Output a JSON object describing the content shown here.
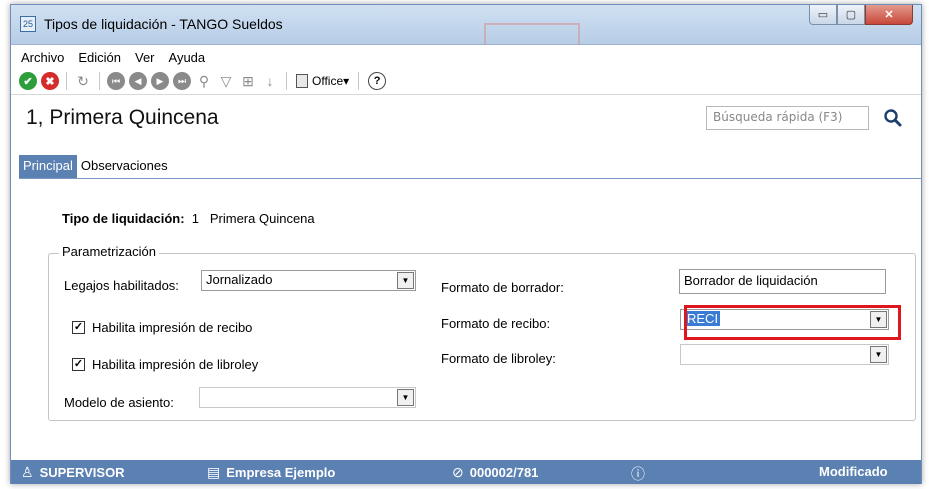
{
  "window": {
    "title": "Tipos de liquidación - TANGO Sueldos",
    "app_icon_glyph": "25"
  },
  "window_controls": {
    "minimize": "▭",
    "maximize": "▢",
    "close": "✕"
  },
  "menu": {
    "archivo": "Archivo",
    "edicion": "Edición",
    "ver": "Ver",
    "ayuda": "Ayuda"
  },
  "toolbar": {
    "accept": "✔",
    "cancel": "✖",
    "refresh": "↻",
    "first": "⏮",
    "prev": "◀",
    "next": "▶",
    "last": "⏭",
    "binoculars": "⚲",
    "filter": "▽",
    "grid": "⊞",
    "sort": "↓",
    "office_label": "Office",
    "office_caret": "▾",
    "help": "?"
  },
  "header": {
    "title": "1, Primera Quincena",
    "search_placeholder": "Búsqueda rápida (F3)"
  },
  "tabs": [
    {
      "label": "Principal",
      "active": true
    },
    {
      "label": "Observaciones",
      "active": false
    }
  ],
  "form": {
    "tipo_label": "Tipo de liquidación:",
    "tipo_code": "1",
    "tipo_name": "Primera Quincena",
    "group_title": "Parametrización",
    "legajos_label": "Legajos habilitados:",
    "legajos_value": "Jornalizado",
    "habilita_recibo_label": "Habilita impresión de recibo",
    "habilita_recibo_checked": true,
    "habilita_libroley_label": "Habilita impresión de libroley",
    "habilita_libroley_checked": true,
    "modelo_asiento_label": "Modelo de asiento:",
    "modelo_asiento_value": "",
    "formato_borrador_label": "Formato de borrador:",
    "formato_borrador_value": "Borrador de liquidación",
    "formato_recibo_label": "Formato de recibo:",
    "formato_recibo_value": "RECI",
    "formato_libroley_label": "Formato de libroley:",
    "formato_libroley_value": "",
    "check_glyph": "✓",
    "arrow_glyph": "▼"
  },
  "status": {
    "user_icon": "♙",
    "user": "SUPERVISOR",
    "company_icon": "▤",
    "company": "Empresa Ejemplo",
    "record_icon": "⊘",
    "record": "000002/781",
    "info_icon": "ⓘ",
    "state": "Modificado"
  },
  "colors": {
    "accent": "#5b80b2",
    "highlight_border": "#e0161f",
    "selection": "#3a7bd5"
  }
}
